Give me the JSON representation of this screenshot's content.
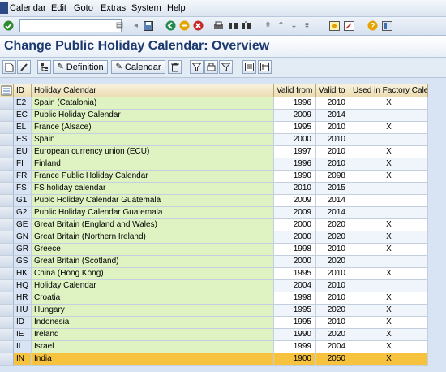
{
  "menu": [
    "Calendar",
    "Edit",
    "Goto",
    "Extras",
    "System",
    "Help"
  ],
  "page_title": "Change Public Holiday Calendar: Overview",
  "toolbar": {
    "definition_label": "Definition",
    "calendar_label": "Calendar"
  },
  "columns": {
    "id": "ID",
    "name": "Holiday Calendar",
    "valid_from": "Valid from",
    "valid_to": "Valid to",
    "factory": "Used in Factory Cale"
  },
  "rows": [
    {
      "id": "E2",
      "name": "Spain (Catalonia)",
      "from": "1996",
      "to": "2010",
      "factory": "X"
    },
    {
      "id": "EC",
      "name": "Public Holiday Calendar",
      "from": "2009",
      "to": "2014",
      "factory": ""
    },
    {
      "id": "EL",
      "name": "France (Alsace)",
      "from": "1995",
      "to": "2010",
      "factory": "X"
    },
    {
      "id": "ES",
      "name": "Spain",
      "from": "2000",
      "to": "2010",
      "factory": ""
    },
    {
      "id": "EU",
      "name": "European currency union (ECU)",
      "from": "1997",
      "to": "2010",
      "factory": "X"
    },
    {
      "id": "FI",
      "name": "Finland",
      "from": "1996",
      "to": "2010",
      "factory": "X"
    },
    {
      "id": "FR",
      "name": "France Public Holiday Calendar",
      "from": "1990",
      "to": "2098",
      "factory": "X"
    },
    {
      "id": "FS",
      "name": "FS holiday calendar",
      "from": "2010",
      "to": "2015",
      "factory": ""
    },
    {
      "id": "G1",
      "name": "Publc Holiday Calendar  Guatemala",
      "from": "2009",
      "to": "2014",
      "factory": ""
    },
    {
      "id": "G2",
      "name": "Public Holiday Calendar Guatemala",
      "from": "2009",
      "to": "2014",
      "factory": ""
    },
    {
      "id": "GE",
      "name": "Great Britain (England and Wales)",
      "from": "2000",
      "to": "2020",
      "factory": "X"
    },
    {
      "id": "GN",
      "name": "Great Britain (Northern Ireland)",
      "from": "2000",
      "to": "2020",
      "factory": "X"
    },
    {
      "id": "GR",
      "name": "Greece",
      "from": "1998",
      "to": "2010",
      "factory": "X"
    },
    {
      "id": "GS",
      "name": "Great Britain (Scotland)",
      "from": "2000",
      "to": "2020",
      "factory": ""
    },
    {
      "id": "HK",
      "name": "China (Hong Kong)",
      "from": "1995",
      "to": "2010",
      "factory": "X"
    },
    {
      "id": "HQ",
      "name": "Holiday Calendar",
      "from": "2004",
      "to": "2010",
      "factory": ""
    },
    {
      "id": "HR",
      "name": "Croatia",
      "from": "1998",
      "to": "2010",
      "factory": "X"
    },
    {
      "id": "HU",
      "name": "Hungary",
      "from": "1995",
      "to": "2020",
      "factory": "X"
    },
    {
      "id": "ID",
      "name": "Indonesia",
      "from": "1995",
      "to": "2010",
      "factory": "X"
    },
    {
      "id": "IE",
      "name": "Ireland",
      "from": "1990",
      "to": "2020",
      "factory": "X"
    },
    {
      "id": "IL",
      "name": "Israel",
      "from": "1999",
      "to": "2004",
      "factory": "X"
    },
    {
      "id": "IN",
      "name": "India",
      "from": "1900",
      "to": "2050",
      "factory": "X"
    }
  ],
  "highlight_color": "#f7c33e",
  "name_column_color": "#dff3c2"
}
